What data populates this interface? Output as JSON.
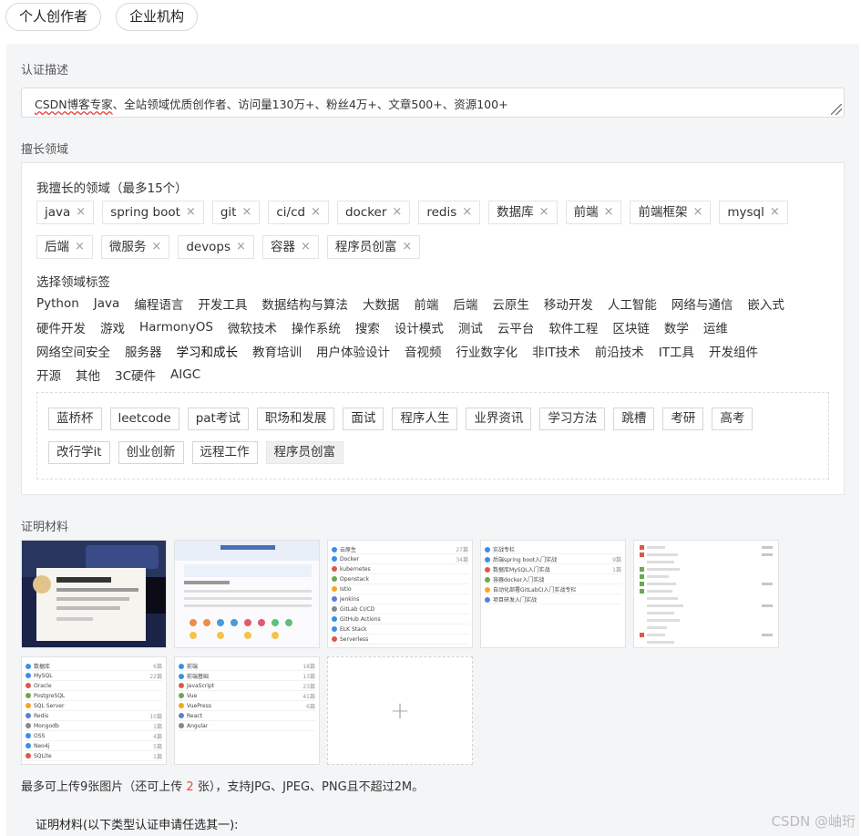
{
  "tabs": [
    "个人创作者",
    "企业机构"
  ],
  "description": {
    "label": "认证描述",
    "value_spell": "CSDN博客专家",
    "value_rest": "、全站领域优质创作者、访问量130万+、粉丝4万+、文章500+、资源100+"
  },
  "domains": {
    "label": "擅长领域",
    "selected_label": "我擅长的领域（最多15个）",
    "selected": [
      "java",
      "spring boot",
      "git",
      "ci/cd",
      "docker",
      "redis",
      "数据库",
      "前端",
      "前端框架",
      "mysql",
      "后端",
      "微服务",
      "devops",
      "容器",
      "程序员创富"
    ],
    "remove_glyph": "×",
    "choose_label": "选择领域标签",
    "tag_lines": [
      [
        "Python",
        "Java",
        "编程语言",
        "开发工具",
        "数据结构与算法",
        "大数据",
        "前端",
        "后端",
        "云原生",
        "移动开发",
        "人工智能",
        "网络与通信",
        "嵌入式"
      ],
      [
        "硬件开发",
        "游戏",
        "HarmonyOS",
        "微软技术",
        "操作系统",
        "搜索",
        "设计模式",
        "测试",
        "云平台",
        "软件工程",
        "区块链",
        "数学",
        "运维"
      ],
      [
        "网络空间安全",
        "服务器",
        "学习和成长",
        "教育培训",
        "用户体验设计",
        "音视频",
        "行业数字化",
        "非IT技术",
        "前沿技术",
        "IT工具",
        "开发组件"
      ],
      [
        "开源",
        "其他",
        "3C硬件",
        "AIGC"
      ]
    ],
    "active_tag": "学习和成长",
    "sub_tags": [
      "蓝桥杯",
      "leetcode",
      "pat考试",
      "职场和发展",
      "面试",
      "程序人生",
      "业界资讯",
      "学习方法",
      "跳槽",
      "考研",
      "高考",
      "改行学it",
      "创业创新",
      "远程工作",
      "程序员创富"
    ],
    "sub_selected": "程序员创富"
  },
  "proof": {
    "label": "证明材料",
    "thumb3": [
      [
        "云原生",
        "27篇"
      ],
      [
        "Docker",
        "34篇"
      ],
      [
        "kubernetes",
        ""
      ],
      [
        "Openstack",
        ""
      ],
      [
        "Istio",
        ""
      ],
      [
        "Jenkins",
        ""
      ],
      [
        "GitLab CI/CD",
        ""
      ],
      [
        "GitHub Actions",
        ""
      ],
      [
        "ELK Stack",
        ""
      ],
      [
        "Serverless",
        ""
      ]
    ],
    "thumb4": [
      [
        "实战专栏",
        ""
      ],
      [
        "后端spring boot入门实战",
        "9篇"
      ],
      [
        "数据库MySQL入门实战",
        "1篇"
      ],
      [
        "容器docker入门实战",
        ""
      ],
      [
        "自动化部署GitLabCI入门实战专栏",
        ""
      ],
      [
        "项目研发入门实战",
        ""
      ]
    ],
    "thumb6": [
      [
        "数据库",
        "6篇"
      ],
      [
        "MySQL",
        "22篇"
      ],
      [
        "Oracle",
        ""
      ],
      [
        "PostgreSQL",
        ""
      ],
      [
        "SQL Server",
        ""
      ],
      [
        "Redis",
        "10篇"
      ],
      [
        "Mongodb",
        "1篇"
      ],
      [
        "OSS",
        "4篇"
      ],
      [
        "Neo4j",
        "5篇"
      ],
      [
        "SQLite",
        "1篇"
      ]
    ],
    "thumb7": [
      [
        "前端",
        "18篇"
      ],
      [
        "前端基础",
        "13篇"
      ],
      [
        "JavaScript",
        "23篇"
      ],
      [
        "Vue",
        "41篇"
      ],
      [
        "VuePress",
        "6篇"
      ],
      [
        "React",
        ""
      ],
      [
        "Angular",
        ""
      ]
    ],
    "upload_glyph": "+",
    "note_prefix": "最多可上传9张图片（还可上传 ",
    "note_count": "2",
    "note_suffix": " 张），支持JPG、JPEG、PNG且不超过2M。",
    "materials_label": "证明材料(以下类型认证申请任选其一):"
  },
  "watermark": "CSDN @岫珩",
  "colors": {
    "accent": "#e94b3b",
    "panel_bg": "#f4f5f7"
  }
}
